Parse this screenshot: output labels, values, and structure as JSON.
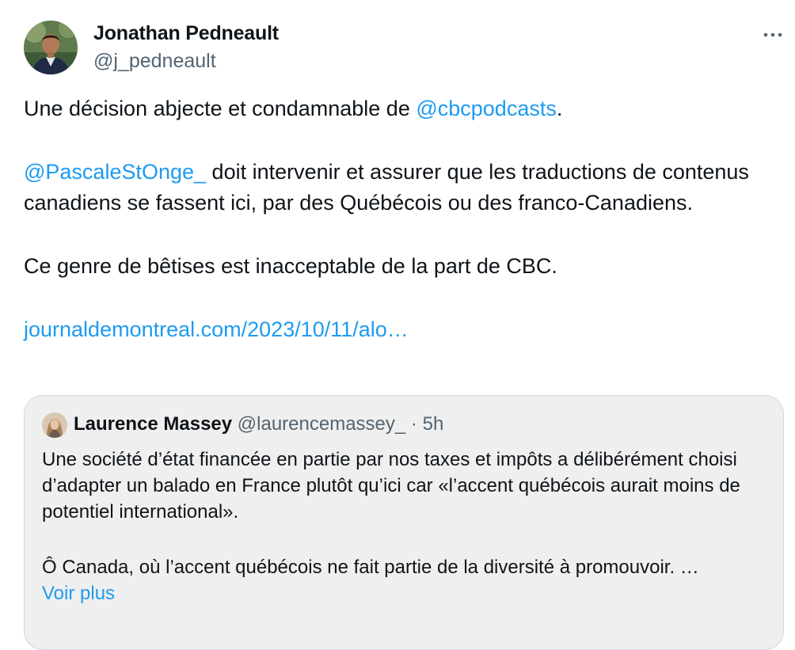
{
  "author": {
    "name": "Jonathan Pedneault",
    "handle": "@j_pedneault",
    "avatar_icon": "profile-photo"
  },
  "more_icon": "ellipsis-horizontal-icon",
  "tweet": {
    "p1_text": "Une décision abjecte et condamnable de ",
    "p1_mention": "@cbcpodcasts",
    "p1_end": ".",
    "p2_mention": "@PascaleStOnge_",
    "p2_text": " doit intervenir et assurer que les traductions de contenus canadiens se fassent ici, par des Québécois ou des franco-Canadiens.",
    "p3_text": "Ce genre de bêtises est inacceptable de la part de CBC.",
    "link_text": "journaldemontreal.com/2023/10/11/alo…"
  },
  "quote": {
    "name": "Laurence Massey",
    "handle": "@laurencemassey_",
    "separator": "·",
    "time": "5h",
    "body_p1": "Une société d’état financée en partie par nos taxes et impôts a délibérément choisi d’adapter un balado en France plutôt qu’ici car «l’accent québécois aurait moins de potentiel international».",
    "body_p2": "Ô Canada, où l’accent québécois ne fait partie de la diversité à promouvoir. …",
    "show_more": "Voir plus"
  },
  "colors": {
    "text": "#0f1419",
    "secondary": "#536471",
    "link": "#1d9bf0",
    "quote_bg": "#efefef",
    "quote_border": "#cfd9de"
  }
}
